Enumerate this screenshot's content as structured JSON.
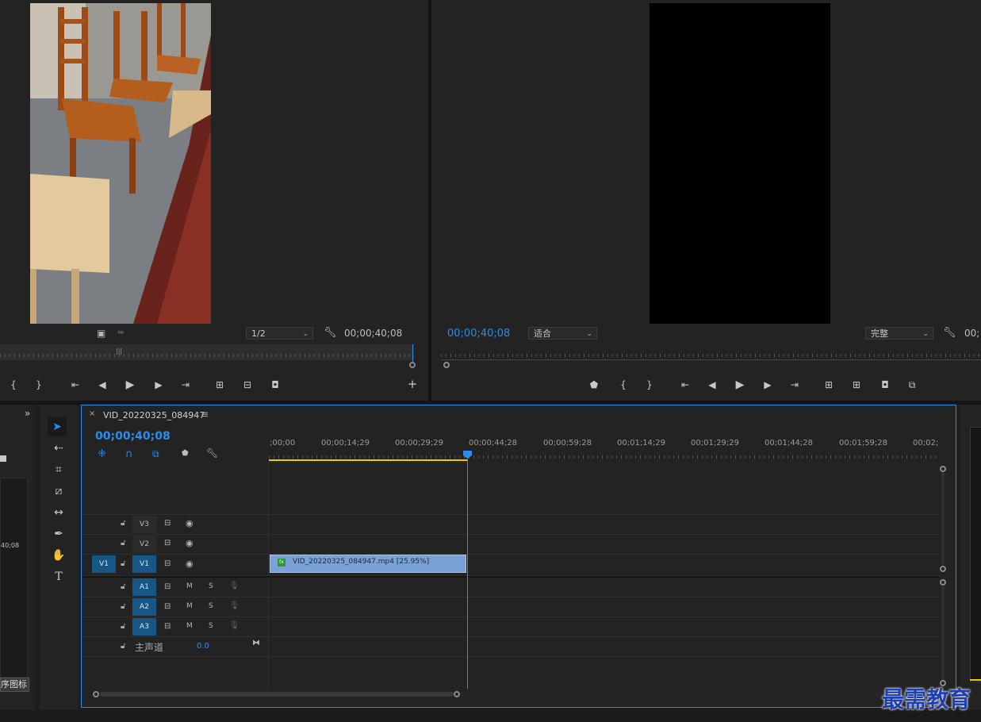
{
  "source_monitor": {
    "zoom_select": "1/2",
    "timecode": "00;00;40;08"
  },
  "program_monitor": {
    "timecode_left": "00;00;40;08",
    "fit_select": "适合",
    "quality_select": "完整",
    "timecode_right": "00;"
  },
  "timeline": {
    "tab_title": "VID_20220325_084947",
    "playhead_timecode": "00;00;40;08",
    "ruler_labels": [
      ";00;00",
      "00;00;14;29",
      "00;00;29;29",
      "00;00;44;28",
      "00;00;59;28",
      "00;01;14;29",
      "00;01;29;29",
      "00;01;44;28",
      "00;01;59;28",
      "00;02;"
    ],
    "video_tracks": [
      {
        "name": "V3",
        "source": ""
      },
      {
        "name": "V2",
        "source": ""
      },
      {
        "name": "V1",
        "source": "V1"
      }
    ],
    "audio_tracks": [
      {
        "name": "A1",
        "m": "M",
        "s": "S"
      },
      {
        "name": "A2",
        "m": "M",
        "s": "S"
      },
      {
        "name": "A3",
        "m": "M",
        "s": "S"
      }
    ],
    "master": {
      "label": "主声道",
      "value": "0.0"
    },
    "clip": {
      "label": "VID_20220325_084947.mp4 [25.95%]",
      "fx": "fx"
    }
  },
  "project_panel": {
    "timecode_fragment": "40;08",
    "tooltip": "序图标"
  },
  "watermark": "最需教育",
  "colors": {
    "accent_blue": "#2d8ceb",
    "clip_blue": "#7ba2d6",
    "track_active": "#175786",
    "work_area_yellow": "#e8d000"
  }
}
